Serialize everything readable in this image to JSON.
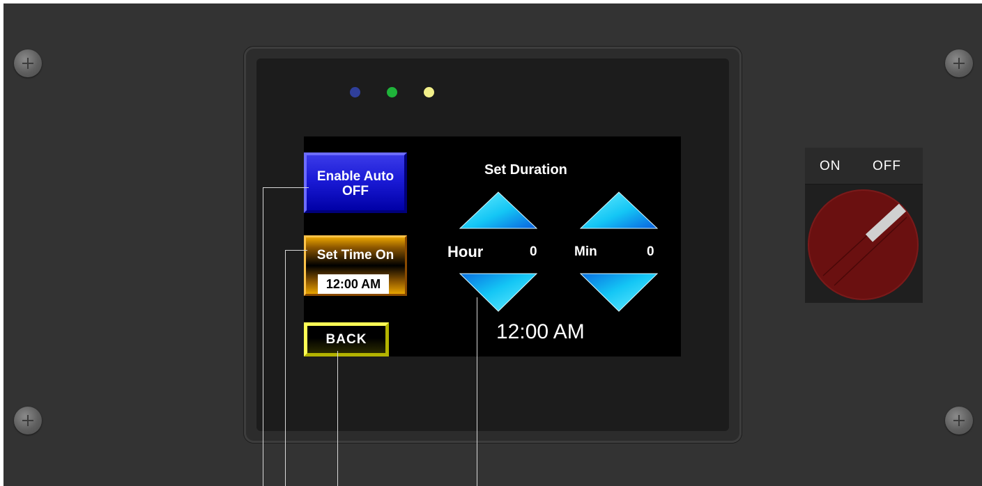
{
  "hmi": {
    "enable_auto": {
      "line1": "Enable Auto",
      "line2": "OFF",
      "color": "#1b1bd6"
    },
    "set_time_on": {
      "label": "Set Time On",
      "value": "12:00 AM",
      "color": "#e8a400"
    },
    "back": {
      "label": "BACK",
      "color": "#ffff55"
    },
    "set_duration": {
      "title": "Set Duration",
      "hour": {
        "label": "Hour",
        "value": "0"
      },
      "min": {
        "label": "Min",
        "value": "0"
      }
    },
    "clock": "12:00 AM"
  },
  "leds": [
    {
      "color": "#2f3f9a",
      "icon": "led-blue"
    },
    {
      "color": "#1fb33a",
      "icon": "led-green"
    },
    {
      "color": "#f2f08a",
      "icon": "led-yellow"
    }
  ],
  "selector_switch": {
    "on_label": "ON",
    "off_label": "OFF",
    "state": "OFF",
    "knob_color": "#6a1010"
  },
  "colors": {
    "panel": "#333333",
    "arrow": "#1ad8ff"
  }
}
